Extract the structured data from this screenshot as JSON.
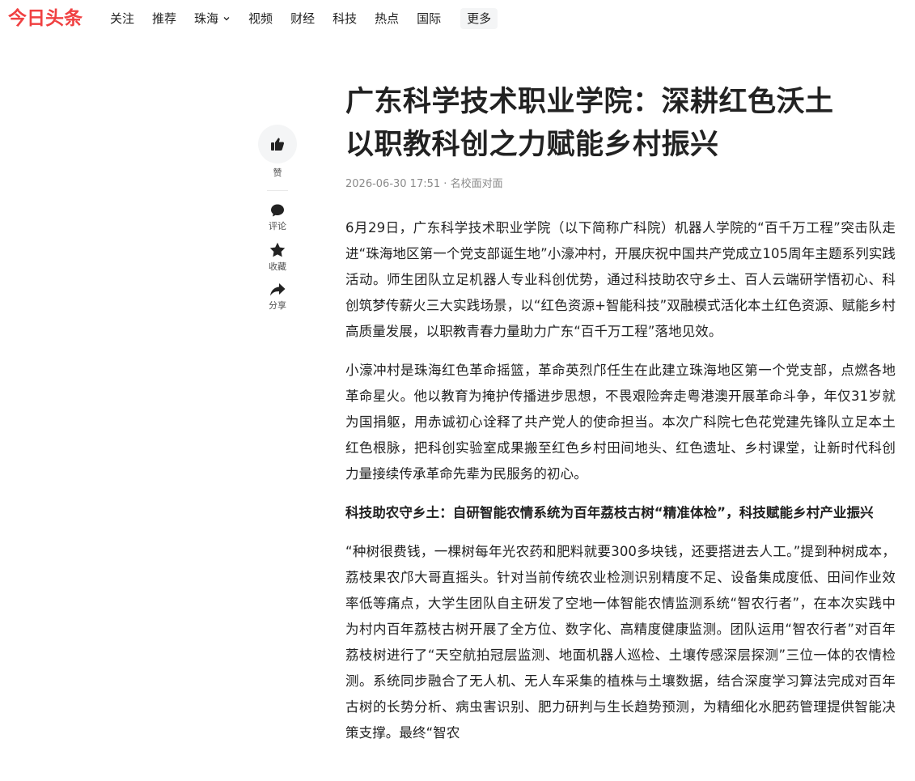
{
  "header": {
    "logo": "今日头条",
    "nav": [
      {
        "label": "关注"
      },
      {
        "label": "推荐"
      },
      {
        "label": "珠海"
      },
      {
        "label": "视频"
      },
      {
        "label": "财经"
      },
      {
        "label": "科技"
      },
      {
        "label": "热点"
      },
      {
        "label": "国际"
      }
    ],
    "more_label": "更多"
  },
  "sidebar": {
    "like_label": "赞",
    "comment_label": "评论",
    "favorite_label": "收藏",
    "share_label": "分享"
  },
  "article": {
    "title_line1": "广东科学技术职业学院：深耕红色沃土",
    "title_line2": "以职教科创之力赋能乡村振兴",
    "date": "2026-06-30 17:51",
    "source": "名校面对面",
    "paragraphs": [
      "6月29日，广东科学技术职业学院（以下简称广科院）机器人学院的“百千万工程”突击队走进“珠海地区第一个党支部诞生地”小濠冲村，开展庆祝中国共产党成立105周年主题系列实践活动。师生团队立足机器人专业科创优势，通过科技助农守乡土、百人云端研学悟初心、科创筑梦传薪火三大实践场景，以“红色资源+智能科技”双融模式活化本土红色资源、赋能乡村高质量发展，以职教青春力量助力广东“百千万工程”落地见效。",
      "小濠冲村是珠海红色革命摇篮，革命英烈邝任生在此建立珠海地区第一个党支部，点燃各地革命星火。他以教育为掩护传播进步思想，不畏艰险奔走粤港澳开展革命斗争，年仅31岁就为国捐躯，用赤诚初心诠释了共产党人的使命担当。本次广科院七色花党建先锋队立足本土红色根脉，把科创实验室成果搬至红色乡村田间地头、红色遗址、乡村课堂，让新时代科创力量接续传承革命先辈为民服务的初心。",
      "科技助农守乡土：自研智能农情系统为百年荔枝古树“精准体检”，科技赋能乡村产业振兴",
      "“种树很费钱，一棵树每年光农药和肥料就要300多块钱，还要搭进去人工。”提到种树成本，荔枝果农邝大哥直摇头。针对当前传统农业检测识别精度不足、设备集成度低、田间作业效率低等痛点，大学生团队自主研发了空地一体智能农情监测系统“智农行者”，在本次实践中为村内百年荔枝古树开展了全方位、数字化、高精度健康监测。团队运用“智农行者”对百年荔枝树进行了“天空航拍冠层监测、地面机器人巡检、土壤传感深层探测”三位一体的农情检测。系统同步融合了无人机、无人车采集的植株与土壤数据，结合深度学习算法完成对百年古树的长势分析、病虫害识别、肥力研判与生长趋势预测，为精细化水肥药管理提供智能决策支撑。最终“智农"
    ]
  },
  "colors": {
    "brand": "#f04142",
    "text": "#222222",
    "meta": "#8a8a8a",
    "icon": "#222222"
  }
}
